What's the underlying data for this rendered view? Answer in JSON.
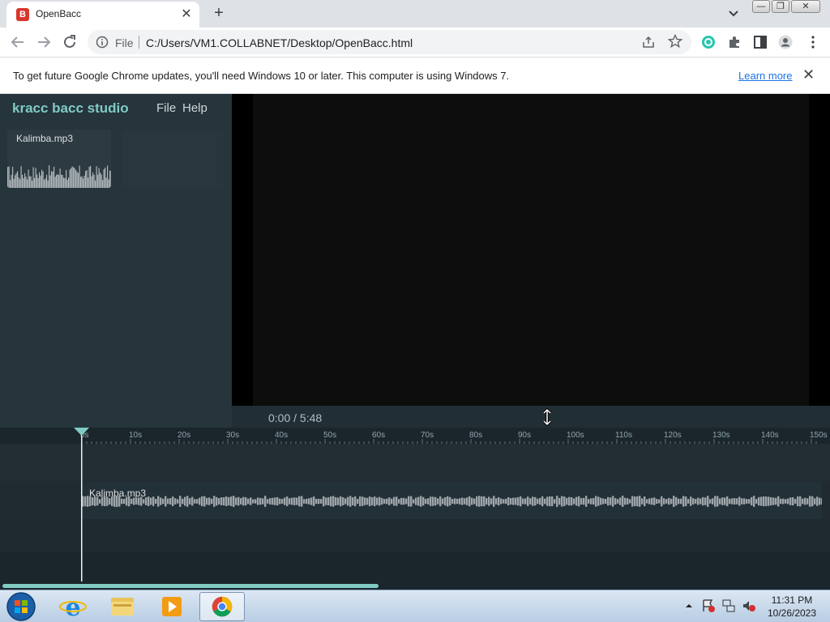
{
  "browser": {
    "tab_title": "OpenBacc",
    "favicon_letter": "B",
    "url_scheme": "File",
    "url": "C:/Users/VM1.COLLABNET/Desktop/OpenBacc.html",
    "infobar_text": "To get future Google Chrome updates, you'll need Windows 10 or later. This computer is using Windows 7.",
    "infobar_link": "Learn more"
  },
  "app": {
    "brand": "kracc bacc studio",
    "menu": [
      "File",
      "Help"
    ],
    "media_items": [
      {
        "name": "Kalimba.mp3"
      }
    ],
    "time_display": "0:00 / 5:48",
    "ruler_ticks": [
      "0s",
      "10s",
      "20s",
      "30s",
      "40s",
      "50s",
      "60s",
      "70s",
      "80s",
      "90s",
      "100s",
      "110s",
      "120s",
      "130s",
      "140s",
      "150s"
    ],
    "clips": [
      {
        "name": "Kalimba.mp3"
      }
    ],
    "accent_color": "#80cbc4"
  },
  "taskbar": {
    "apps": [
      "start-orb",
      "internet-explorer",
      "file-explorer",
      "media-player",
      "chrome"
    ],
    "clock_time": "11:31 PM",
    "clock_date": "10/26/2023"
  }
}
